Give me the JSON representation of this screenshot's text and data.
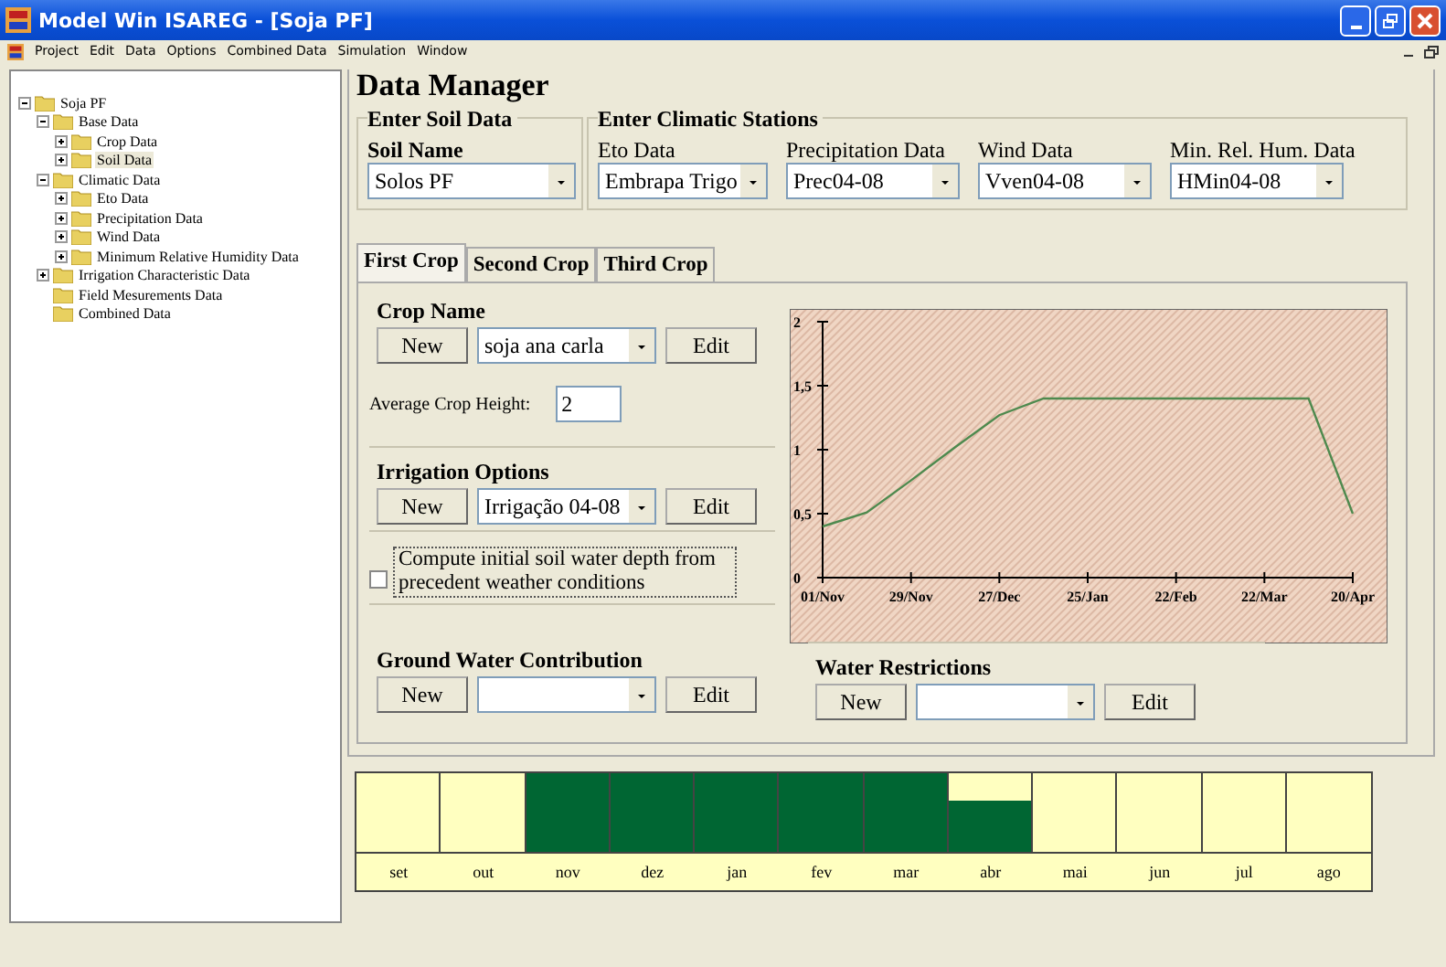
{
  "window": {
    "title": "Model Win ISAREG - [Soja PF]"
  },
  "menu": [
    "Project",
    "Edit",
    "Data",
    "Options",
    "Combined Data",
    "Simulation",
    "Window"
  ],
  "tree": [
    {
      "label": "Soja PF",
      "expanded": true,
      "selected": false,
      "children": [
        {
          "label": "Base Data",
          "expanded": true,
          "selected": false,
          "children": [
            {
              "label": "Crop Data",
              "expanded": false,
              "selected": false
            },
            {
              "label": "Soil Data",
              "expanded": false,
              "selected": true
            }
          ]
        },
        {
          "label": "Climatic Data",
          "expanded": true,
          "selected": false,
          "children": [
            {
              "label": "Eto Data",
              "expanded": false,
              "selected": false
            },
            {
              "label": "Precipitation Data",
              "expanded": false,
              "selected": false
            },
            {
              "label": "Wind Data",
              "expanded": false,
              "selected": false
            },
            {
              "label": "Minimum Relative Humidity Data",
              "expanded": false,
              "selected": false
            }
          ]
        },
        {
          "label": "Irrigation Characteristic Data",
          "expanded": false,
          "selected": false
        },
        {
          "label": "Field Mesurements Data",
          "selected": false
        },
        {
          "label": "Combined Data",
          "selected": false
        }
      ]
    }
  ],
  "heading": "Data Manager",
  "soil": {
    "title": "Enter Soil Data",
    "label": "Soil Name",
    "value": "Solos  PF"
  },
  "climatic": {
    "title": "Enter Climatic Stations",
    "fields": [
      {
        "label": "Eto Data",
        "value": "Embrapa Trigo"
      },
      {
        "label": "Precipitation Data",
        "value": "Prec04-08"
      },
      {
        "label": "Wind Data",
        "value": "Vven04-08"
      },
      {
        "label": "Min. Rel. Hum. Data",
        "value": "HMin04-08"
      }
    ]
  },
  "tabs": [
    {
      "label": "First Crop",
      "selected": true
    },
    {
      "label": "Second Crop",
      "selected": false
    },
    {
      "label": "Third Crop",
      "selected": false
    }
  ],
  "crop": {
    "title": "Crop Name",
    "new": "New",
    "value": "soja ana carla",
    "edit": "Edit"
  },
  "height": {
    "label": "Average Crop Height:",
    "value": "2"
  },
  "irrigation": {
    "title": "Irrigation Options",
    "new": "New",
    "value": "Irrigação 04-08",
    "edit": "Edit"
  },
  "compute": {
    "label": "Compute initial soil water depth from precedent weather conditions",
    "checked": false
  },
  "ground": {
    "title": "Ground  Water Contribution",
    "new": "New",
    "edit": "Edit"
  },
  "restrictions": {
    "title": "Water Restrictions",
    "new": "New",
    "edit": "Edit"
  },
  "chart": {
    "chart_data": {
      "type": "line",
      "categories": [
        "01/Nov",
        null,
        "29/Nov",
        null,
        "27/Dec",
        null,
        "25/Jan",
        null,
        "22/Feb",
        null,
        "22/Mar",
        null,
        "20/Apr"
      ],
      "series": [
        {
          "color": "#4e8a4e",
          "values": [
            0.4,
            0.51,
            0.76,
            1.02,
            1.27,
            1.4,
            1.4,
            1.4,
            1.4,
            1.4,
            1.4,
            1.4,
            0.5
          ]
        }
      ],
      "ylim": [
        0,
        2
      ],
      "yticks": [
        0,
        {
          "value": 0.5,
          "label": "0,5"
        },
        1,
        {
          "value": 1.5,
          "label": "1,5"
        },
        2
      ]
    }
  },
  "months": [
    {
      "label": "set",
      "kind": "empty"
    },
    {
      "label": "out",
      "kind": "empty"
    },
    {
      "label": "nov",
      "kind": "full"
    },
    {
      "label": "dez",
      "kind": "full"
    },
    {
      "label": "jan",
      "kind": "full"
    },
    {
      "label": "fev",
      "kind": "full"
    },
    {
      "label": "mar",
      "kind": "full"
    },
    {
      "label": "abr",
      "kind": "partial"
    },
    {
      "label": "mai",
      "kind": "empty"
    },
    {
      "label": "jun",
      "kind": "empty"
    },
    {
      "label": "jul",
      "kind": "empty"
    },
    {
      "label": "ago",
      "kind": "empty"
    }
  ]
}
